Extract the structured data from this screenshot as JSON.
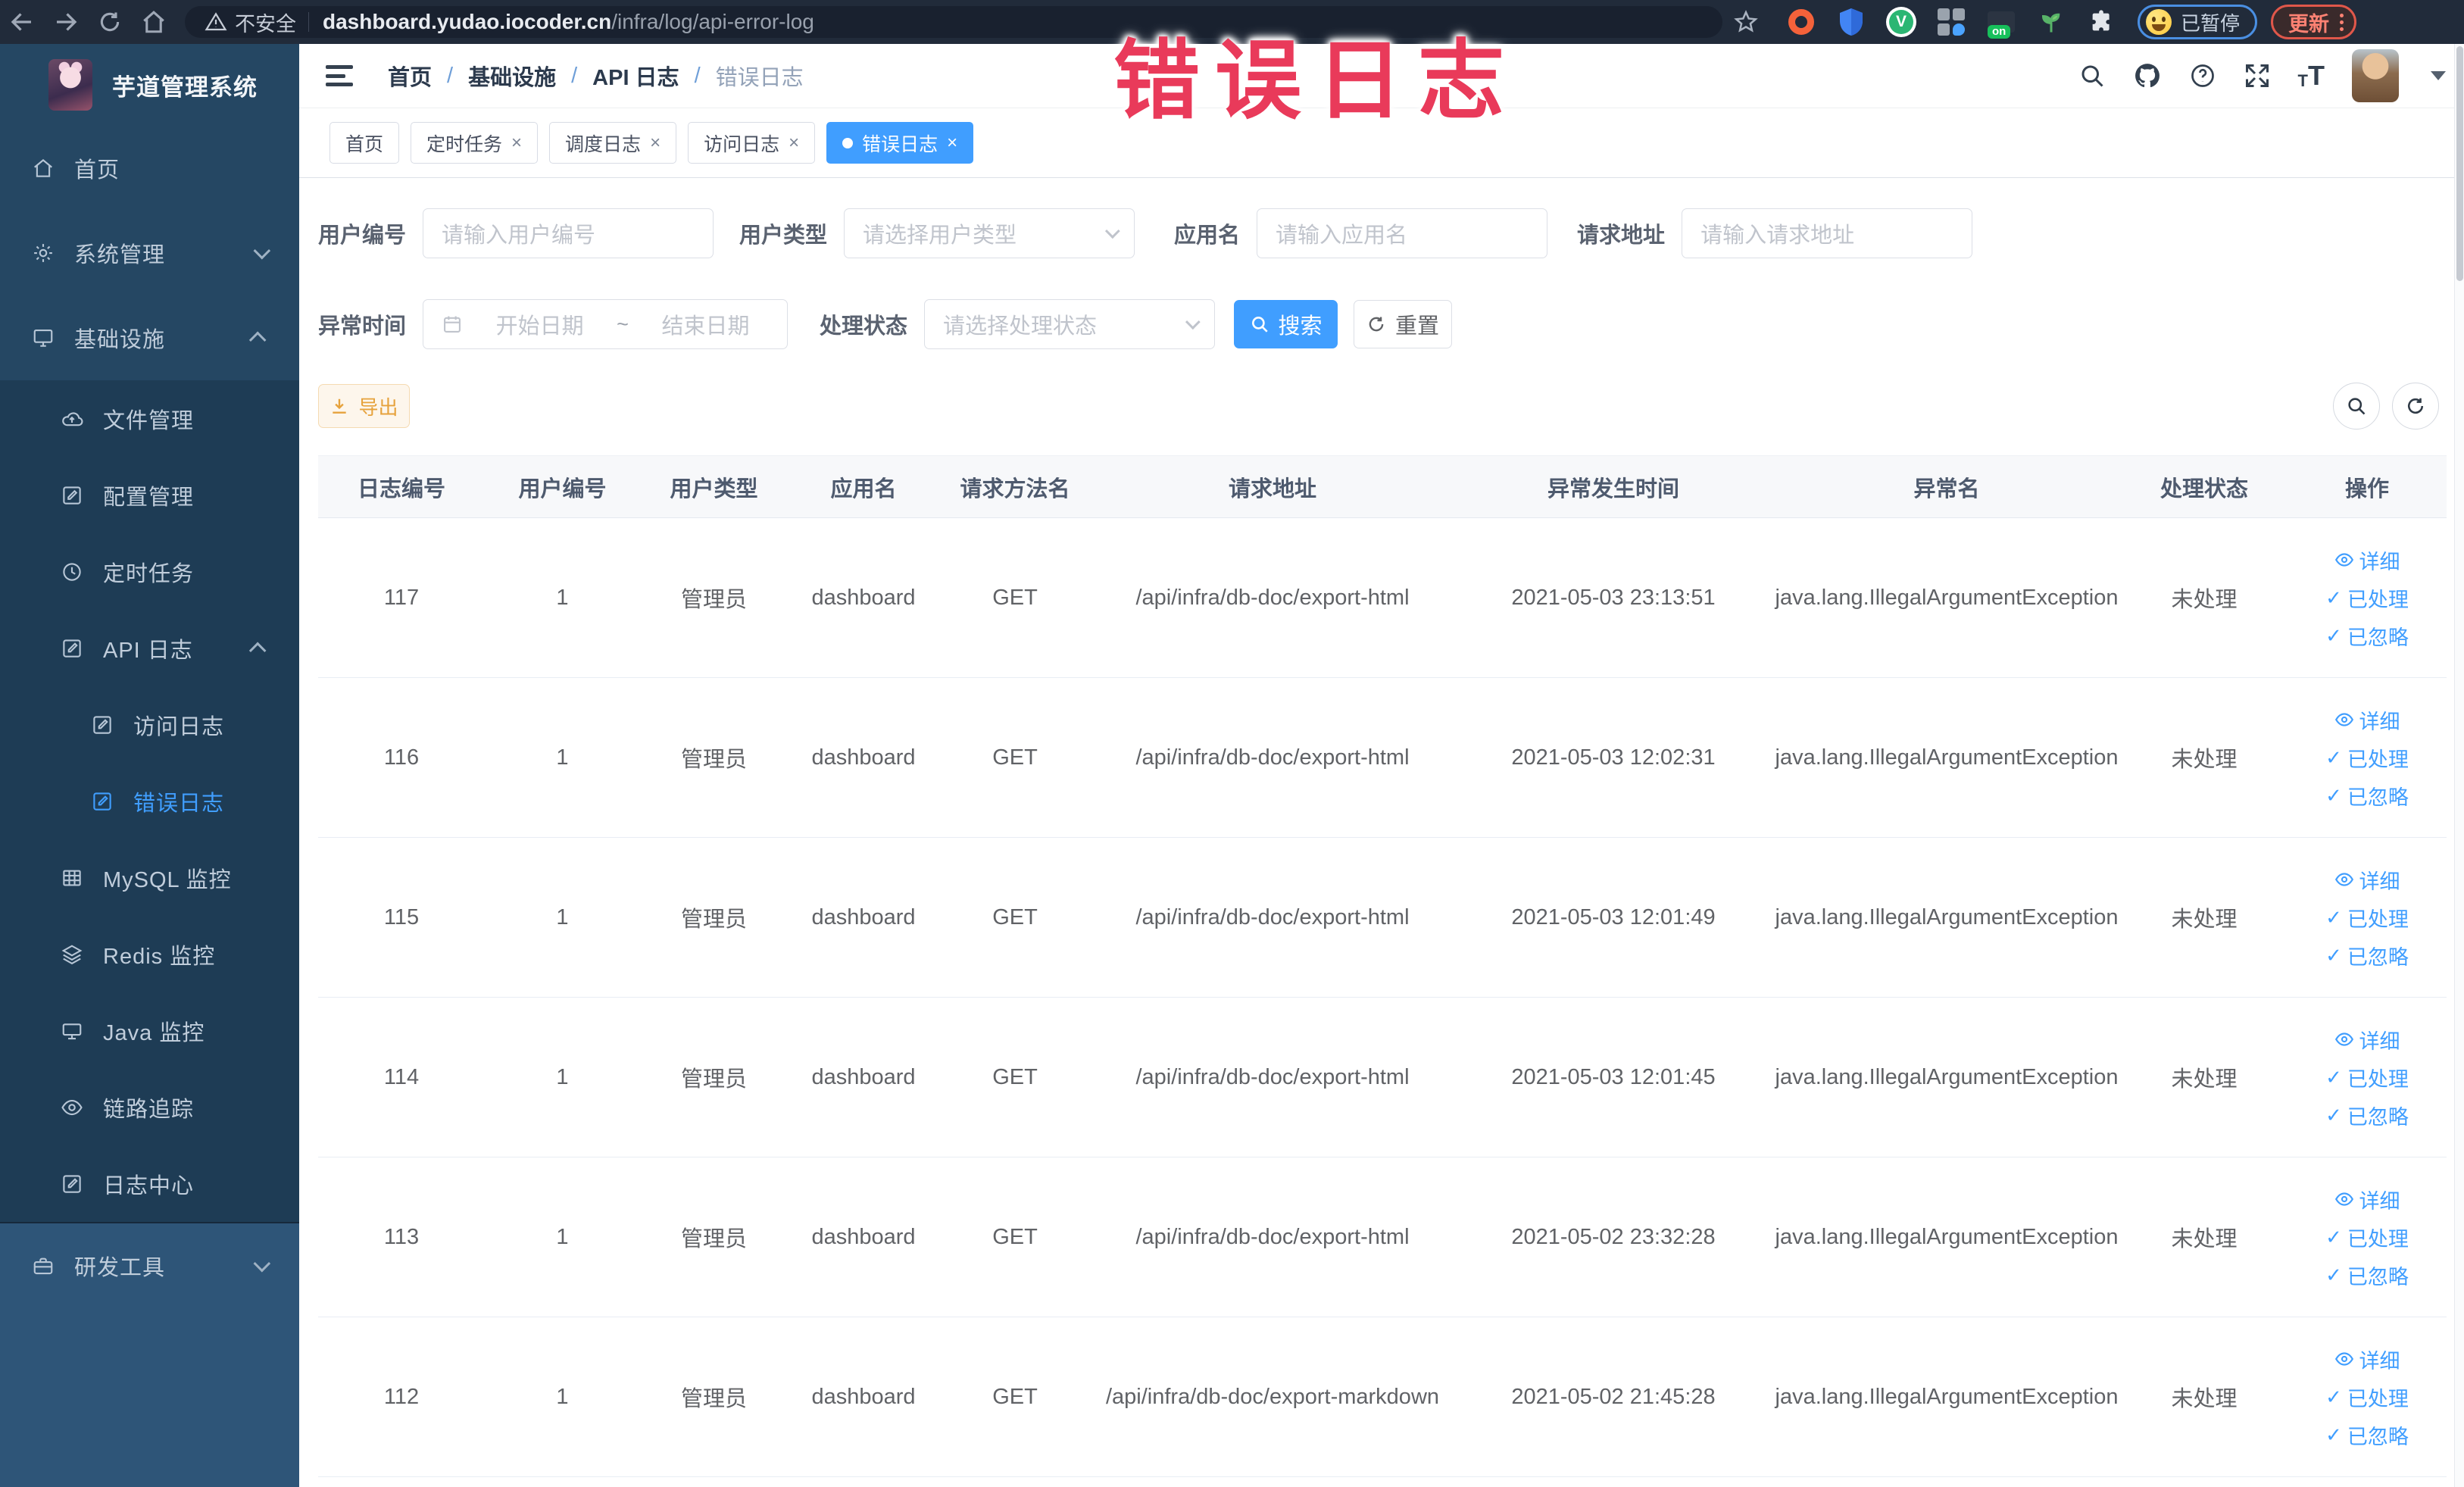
{
  "browser": {
    "security_label": "不安全",
    "url_domain": "dashboard.yudao.iocoder.cn",
    "url_path": "/infra/log/api-error-log",
    "paused_badge": "已暂停",
    "update_button": "更新"
  },
  "annotation": {
    "text": "错误日志",
    "color": "#e93a5a"
  },
  "sidebar": {
    "title": "芋道管理系统",
    "items": [
      {
        "icon": "home-icon",
        "label": "首页",
        "level": 1,
        "zone": "top"
      },
      {
        "icon": "gear-icon",
        "label": "系统管理",
        "level": 1,
        "zone": "top",
        "chevron": "down"
      },
      {
        "icon": "monitor-icon",
        "label": "基础设施",
        "level": 1,
        "zone": "top",
        "chevron": "up"
      },
      {
        "icon": "cloud-upload-icon",
        "label": "文件管理",
        "level": 2,
        "zone": "sub"
      },
      {
        "icon": "edit-icon",
        "label": "配置管理",
        "level": 2,
        "zone": "sub"
      },
      {
        "icon": "clock-icon",
        "label": "定时任务",
        "level": 2,
        "zone": "sub"
      },
      {
        "icon": "doc-edit-icon",
        "label": "API 日志",
        "level": 2,
        "zone": "sub",
        "chevron": "up"
      },
      {
        "icon": "doc-edit-icon",
        "label": "访问日志",
        "level": 3,
        "zone": "sub"
      },
      {
        "icon": "doc-edit-icon",
        "label": "错误日志",
        "level": 3,
        "zone": "sub",
        "active": true
      },
      {
        "icon": "table-icon",
        "label": "MySQL 监控",
        "level": 2,
        "zone": "sub"
      },
      {
        "icon": "layers-icon",
        "label": "Redis 监控",
        "level": 2,
        "zone": "sub"
      },
      {
        "icon": "desktop-icon",
        "label": "Java 监控",
        "level": 2,
        "zone": "sub"
      },
      {
        "icon": "eye-icon",
        "label": "链路追踪",
        "level": 2,
        "zone": "sub"
      },
      {
        "icon": "doc-edit-icon",
        "label": "日志中心",
        "level": 2,
        "zone": "sub"
      },
      {
        "icon": "toolbox-icon",
        "label": "研发工具",
        "level": 1,
        "zone": "bottom",
        "chevron": "down"
      }
    ]
  },
  "breadcrumb": [
    "首页",
    "基础设施",
    "API 日志",
    "错误日志"
  ],
  "tagbar": [
    {
      "label": "首页",
      "closable": false,
      "active": false
    },
    {
      "label": "定时任务",
      "closable": true,
      "active": false
    },
    {
      "label": "调度日志",
      "closable": true,
      "active": false
    },
    {
      "label": "访问日志",
      "closable": true,
      "active": false
    },
    {
      "label": "错误日志",
      "closable": true,
      "active": true
    }
  ],
  "filters": {
    "user_id": {
      "label": "用户编号",
      "placeholder": "请输入用户编号"
    },
    "user_type": {
      "label": "用户类型",
      "placeholder": "请选择用户类型"
    },
    "app_name": {
      "label": "应用名",
      "placeholder": "请输入应用名"
    },
    "request_url": {
      "label": "请求地址",
      "placeholder": "请输入请求地址"
    },
    "exception_time": {
      "label": "异常时间",
      "start_placeholder": "开始日期",
      "separator": "~",
      "end_placeholder": "结束日期"
    },
    "process_status": {
      "label": "处理状态",
      "placeholder": "请选择处理状态"
    },
    "search_button": "搜索",
    "reset_button": "重置"
  },
  "toolbar": {
    "export_button": "导出"
  },
  "table": {
    "columns": [
      "日志编号",
      "用户编号",
      "用户类型",
      "应用名",
      "请求方法名",
      "请求地址",
      "异常发生时间",
      "异常名",
      "处理状态",
      "操作"
    ],
    "row_actions": [
      "详细",
      "已处理",
      "已忽略"
    ],
    "rows": [
      {
        "id": "117",
        "user_id": "1",
        "user_type": "管理员",
        "app": "dashboard",
        "method": "GET",
        "url": "/api/infra/db-doc/export-html",
        "time": "2021-05-03 23:13:51",
        "exception": "java.lang.IllegalArgumentException",
        "status": "未处理"
      },
      {
        "id": "116",
        "user_id": "1",
        "user_type": "管理员",
        "app": "dashboard",
        "method": "GET",
        "url": "/api/infra/db-doc/export-html",
        "time": "2021-05-03 12:02:31",
        "exception": "java.lang.IllegalArgumentException",
        "status": "未处理"
      },
      {
        "id": "115",
        "user_id": "1",
        "user_type": "管理员",
        "app": "dashboard",
        "method": "GET",
        "url": "/api/infra/db-doc/export-html",
        "time": "2021-05-03 12:01:49",
        "exception": "java.lang.IllegalArgumentException",
        "status": "未处理"
      },
      {
        "id": "114",
        "user_id": "1",
        "user_type": "管理员",
        "app": "dashboard",
        "method": "GET",
        "url": "/api/infra/db-doc/export-html",
        "time": "2021-05-03 12:01:45",
        "exception": "java.lang.IllegalArgumentException",
        "status": "未处理"
      },
      {
        "id": "113",
        "user_id": "1",
        "user_type": "管理员",
        "app": "dashboard",
        "method": "GET",
        "url": "/api/infra/db-doc/export-html",
        "time": "2021-05-02 23:32:28",
        "exception": "java.lang.IllegalArgumentException",
        "status": "未处理"
      },
      {
        "id": "112",
        "user_id": "1",
        "user_type": "管理员",
        "app": "dashboard",
        "method": "GET",
        "url": "/api/infra/db-doc/export-markdown",
        "time": "2021-05-02 21:45:28",
        "exception": "java.lang.IllegalArgumentException",
        "status": "未处理"
      }
    ]
  },
  "colors": {
    "accent": "#409eff",
    "warning": "#e6a23c",
    "sidebar_active": "#409eff"
  }
}
